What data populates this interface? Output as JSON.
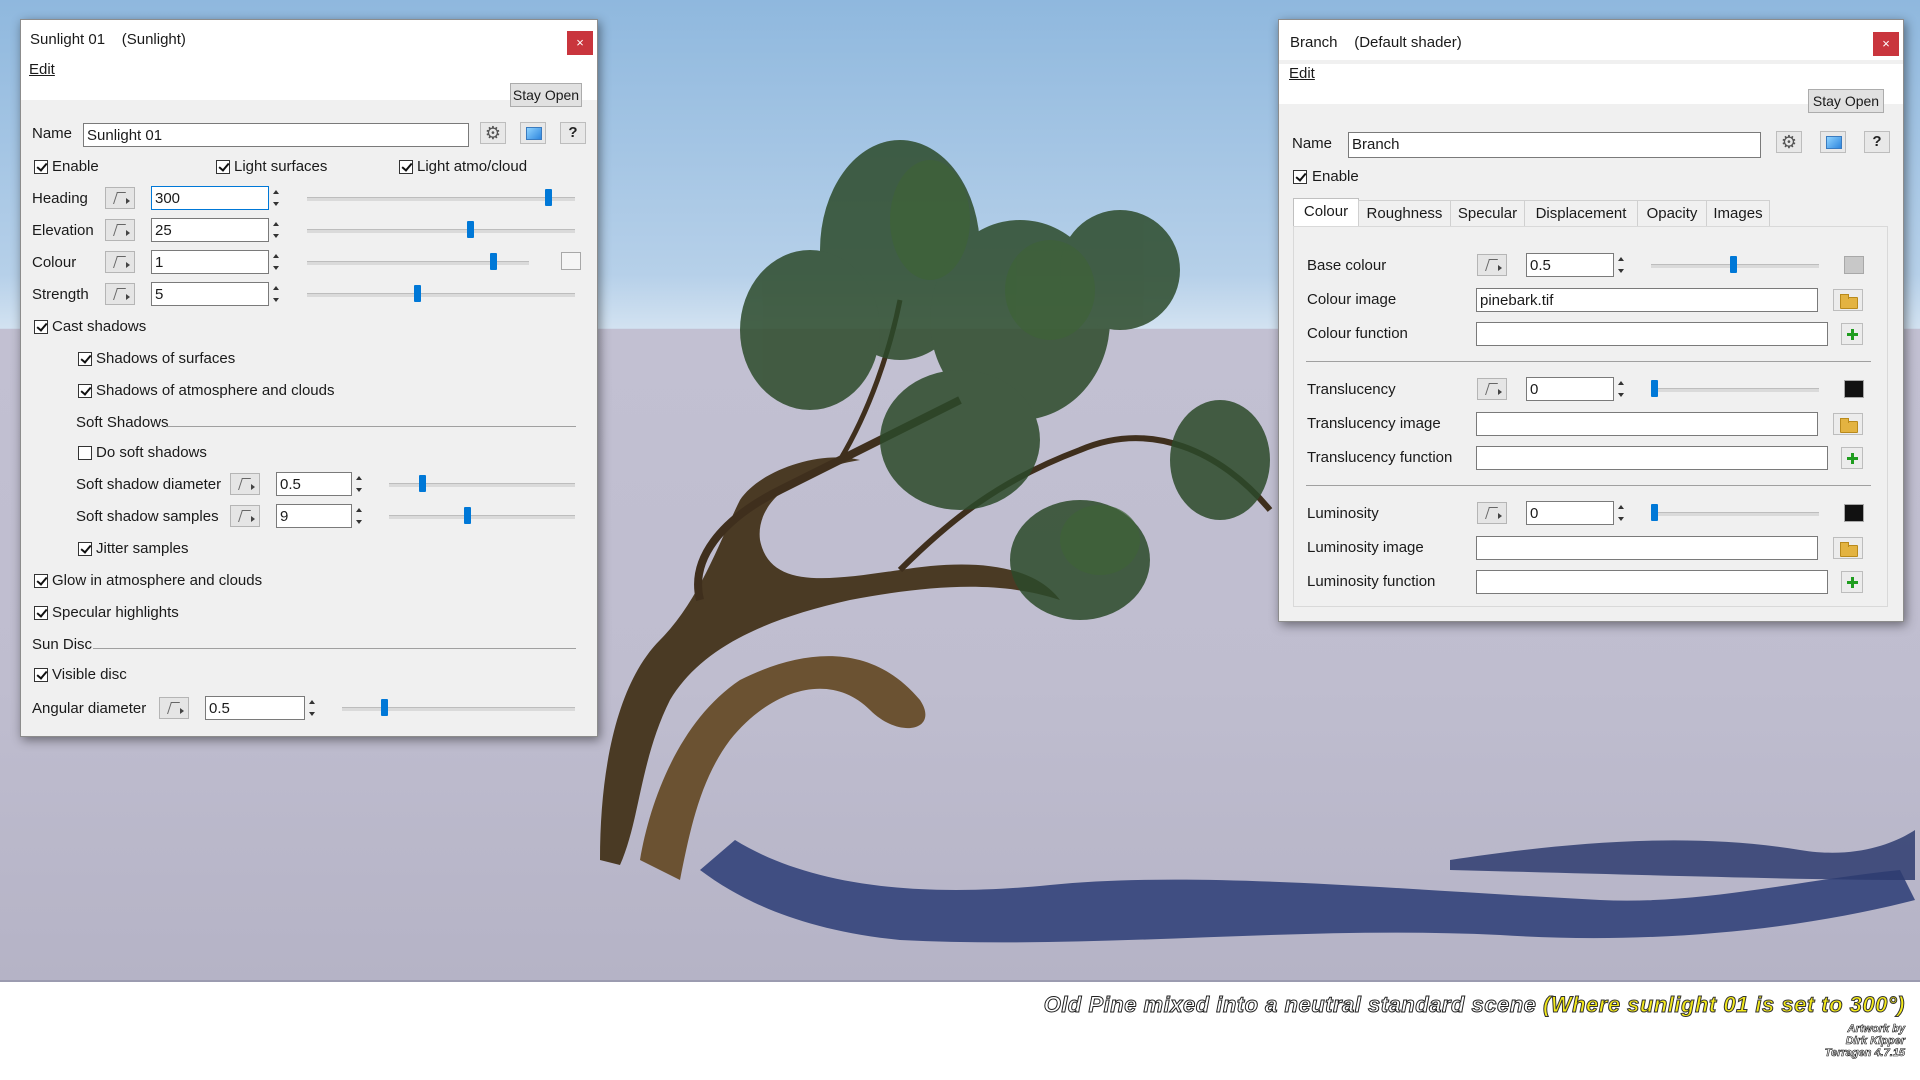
{
  "sunlight": {
    "title": "Sunlight 01    (Sunlight)",
    "close": "×",
    "menu": "Edit",
    "stay_open": "Stay Open",
    "name_label": "Name",
    "name_value": "Sunlight 01",
    "help": "?",
    "enable": "Enable",
    "light_surfaces": "Light surfaces",
    "light_atmo": "Light atmo/cloud",
    "heading_label": "Heading",
    "heading_value": "300",
    "heading_level": 0.9,
    "elevation_label": "Elevation",
    "elevation_value": "25",
    "elevation_level": 0.61,
    "colour_label": "Colour",
    "colour_value": "1",
    "colour_level": 0.84,
    "strength_label": "Strength",
    "strength_value": "5",
    "strength_level": 0.41,
    "cast_shadows": "Cast shadows",
    "shadows_surfaces": "Shadows of surfaces",
    "shadows_atmo": "Shadows of atmosphere and clouds",
    "soft_shadows_header": "Soft Shadows",
    "do_soft_shadows": "Do soft shadows",
    "soft_diameter_label": "Soft shadow diameter",
    "soft_diameter_value": "0.5",
    "soft_diameter_level": 0.18,
    "soft_samples_label": "Soft shadow samples",
    "soft_samples_value": "9",
    "soft_samples_level": 0.42,
    "jitter": "Jitter samples",
    "glow": "Glow in atmosphere and clouds",
    "specular": "Specular highlights",
    "sun_disc_header": "Sun Disc",
    "visible_disc": "Visible disc",
    "angular_label": "Angular diameter",
    "angular_value": "0.5",
    "angular_level": 0.18
  },
  "branch": {
    "title": "Branch    (Default shader)",
    "close": "×",
    "menu": "Edit",
    "stay_open": "Stay Open",
    "name_label": "Name",
    "name_value": "Branch",
    "help": "?",
    "enable": "Enable",
    "tabs": [
      "Colour",
      "Roughness",
      "Specular",
      "Displacement",
      "Opacity",
      "Images"
    ],
    "base_colour_label": "Base colour",
    "base_colour_value": "0.5",
    "base_colour_level": 0.49,
    "colour_image_label": "Colour image",
    "colour_image_value": "pinebark.tif",
    "colour_function_label": "Colour function",
    "translucency_label": "Translucency",
    "translucency_value": "0",
    "translucency_level": 0.0,
    "translucency_image_label": "Translucency image",
    "translucency_function_label": "Translucency function",
    "luminosity_label": "Luminosity",
    "luminosity_value": "0",
    "luminosity_level": 0.0,
    "luminosity_image_label": "Luminosity image",
    "luminosity_function_label": "Luminosity function"
  },
  "caption": {
    "main": "Old Pine mixed into a neutral standard scene ",
    "highlight": "(Where sunlight 01 is set to 300°)",
    "credit_1": "Artwork by",
    "credit_2": "Dirk Kipper",
    "credit_3": "Terragen 4.7.15"
  },
  "colors": {
    "slider_thumb": "#0078d7",
    "close_button": "#c9353d",
    "caption_highlight": "#f4ea1a"
  }
}
